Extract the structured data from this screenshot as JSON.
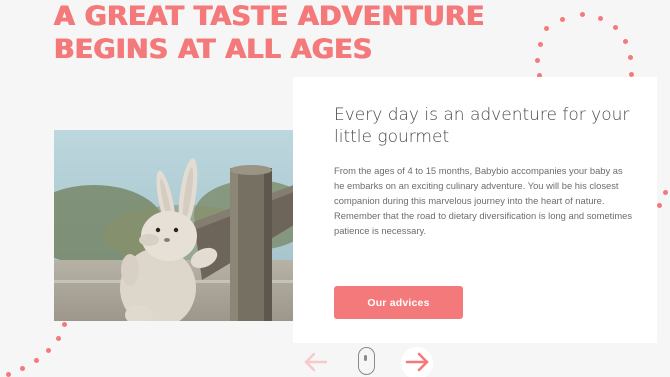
{
  "hero": {
    "headline_line1": "A GREAT TASTE ADVENTURE",
    "headline_line2": "BEGINS AT ALL AGES"
  },
  "card": {
    "title": "Every day is an adventure for your little gourmet",
    "body": "From the ages of 4 to 15 months, Babybio accompanies your baby as he embarks on an exciting culinary adventure. You will be his closest companion during this marvelous journey into the heart of nature. Remember that the road to dietary diversification is long and sometimes patience is necessary.",
    "cta_label": "Our advices"
  },
  "nav": {
    "prev_icon": "arrow-left-icon",
    "next_icon": "arrow-right-icon",
    "scroll_icon": "mouse-scroll-icon"
  },
  "photo": {
    "icon": "plush-rabbit-image"
  },
  "colors": {
    "accent": "#f4797a",
    "background": "#f6f6f6",
    "card": "#ffffff",
    "text_dark": "#4a4a4a",
    "text_body": "#6d6d6d"
  }
}
